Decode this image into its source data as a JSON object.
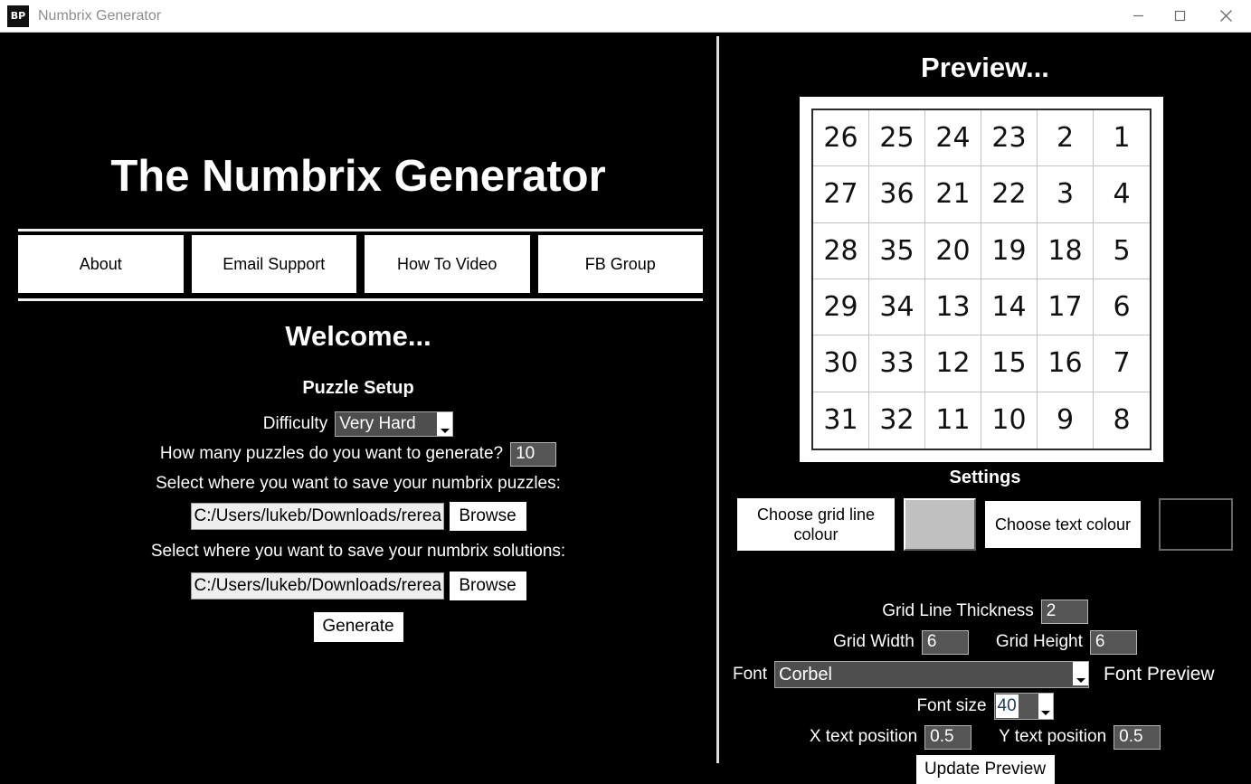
{
  "window": {
    "logo_text": "BP",
    "title": "Numbrix Generator",
    "controls": {
      "minimize": "minimize-icon",
      "maximize": "maximize-icon",
      "close": "close-icon"
    }
  },
  "left": {
    "app_title": "The Numbrix Generator",
    "nav": [
      {
        "label": "About"
      },
      {
        "label": "Email Support"
      },
      {
        "label": "How To Video"
      },
      {
        "label": "FB Group"
      }
    ],
    "welcome_heading": "Welcome...",
    "setup_heading": "Puzzle Setup",
    "difficulty_label": "Difficulty",
    "difficulty_value": "Very Hard",
    "count_label": "How many puzzles do you want to generate?",
    "count_value": "10",
    "puzzles_path_label": "Select where you want to save your numbrix puzzles:",
    "puzzles_path_value": "C:/Users/lukeb/Downloads/rerea",
    "puzzles_browse_label": "Browse",
    "solutions_path_label": "Select where you want to save your numbrix solutions:",
    "solutions_path_value": "C:/Users/lukeb/Downloads/rerea",
    "solutions_browse_label": "Browse",
    "generate_label": "Generate"
  },
  "right": {
    "preview_heading": "Preview...",
    "settings_heading": "Settings",
    "gridline_colour_label": "Choose grid line colour",
    "gridline_colour_value": "#c0c0c0",
    "text_colour_label": "Choose text colour",
    "text_colour_value": "#000000",
    "thickness_label": "Grid Line Thickness",
    "thickness_value": "2",
    "grid_width_label": "Grid Width",
    "grid_width_value": "6",
    "grid_height_label": "Grid Height",
    "grid_height_value": "6",
    "font_label": "Font",
    "font_value": "Corbel",
    "font_preview_label": "Font Preview",
    "font_size_label": "Font size",
    "font_size_value": "40",
    "x_pos_label": "X text position",
    "x_pos_value": "0.5",
    "y_pos_label": "Y text position",
    "y_pos_value": "0.5",
    "update_preview_label": "Update Preview"
  },
  "preview_grid": {
    "columns": 6,
    "rows": 6,
    "cells": [
      [
        "26",
        "25",
        "24",
        "23",
        "2",
        "1"
      ],
      [
        "27",
        "36",
        "21",
        "22",
        "3",
        "4"
      ],
      [
        "28",
        "35",
        "20",
        "19",
        "18",
        "5"
      ],
      [
        "29",
        "34",
        "13",
        "14",
        "17",
        "6"
      ],
      [
        "30",
        "33",
        "12",
        "15",
        "16",
        "7"
      ],
      [
        "31",
        "32",
        "11",
        "10",
        "9",
        "8"
      ]
    ]
  }
}
